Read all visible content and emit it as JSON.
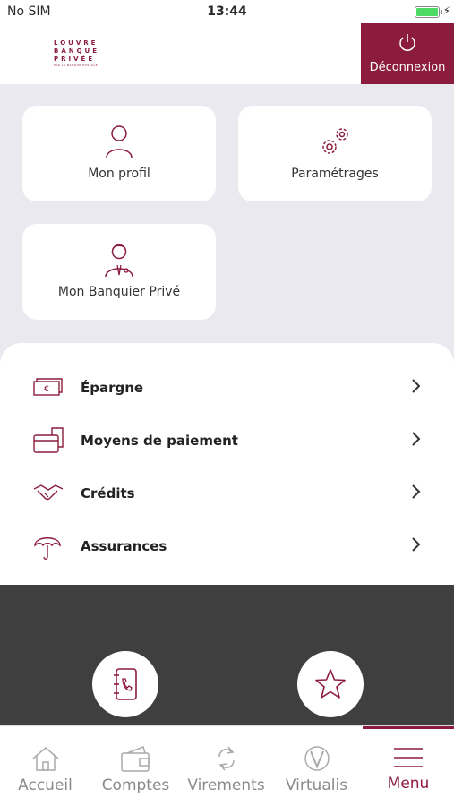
{
  "status_bar": {
    "carrier": "No SIM",
    "time": "13:44"
  },
  "header": {
    "logo_line1": "LOUVRE",
    "logo_line2": "BANQUE",
    "logo_line3": "PRIVÉE",
    "logo_sub": "PAR LA BANQUE POSTALE",
    "logout_label": "Déconnexion",
    "accent_color": "#8b1c3d"
  },
  "cards": [
    {
      "label": "Mon profil",
      "icon": "person-icon"
    },
    {
      "label": "Paramétrages",
      "icon": "gears-icon"
    },
    {
      "label": "Mon Banquier Privé",
      "icon": "banker-icon"
    }
  ],
  "menu_items": [
    {
      "label": "Épargne",
      "icon": "banknotes-icon"
    },
    {
      "label": "Moyens de paiement",
      "icon": "cards-icon"
    },
    {
      "label": "Crédits",
      "icon": "handshake-icon"
    },
    {
      "label": "Assurances",
      "icon": "umbrella-icon"
    }
  ],
  "fabs": [
    {
      "icon": "phone-book-icon"
    },
    {
      "icon": "star-icon"
    }
  ],
  "tabbar": {
    "items": [
      {
        "label": "Accueil",
        "icon": "house-icon"
      },
      {
        "label": "Comptes",
        "icon": "wallet-icon"
      },
      {
        "label": "Virements",
        "icon": "transfer-icon"
      },
      {
        "label": "Virtualis",
        "icon": "virtualis-icon"
      },
      {
        "label": "Menu",
        "icon": "hamburger-icon"
      }
    ],
    "active": "Menu"
  }
}
